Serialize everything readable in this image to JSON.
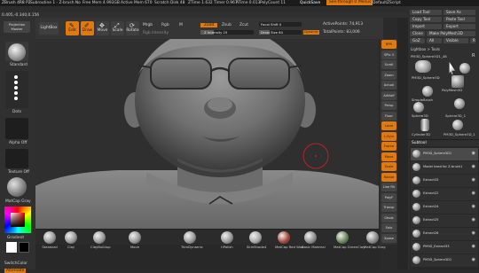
{
  "titlebar": {
    "app": "ZBrush 4R8 P2",
    "subtitle": "Subroutine 1 - Z-brush No",
    "free_mem": "Free Mem 4.993GB",
    "active_mem": "Active Mem 670",
    "scratch_disk": "Scratch Disk 48",
    "ztime": "ZTime 1.632 Timer 0.967",
    "atime": "ATime 0.013",
    "polycount": "PolyCount 11",
    "quicksave": "QuickSave",
    "see_through": "See-through 0",
    "menus_button": "Menus",
    "default_script": "DefaultZScript"
  },
  "menus": [
    "Alpha",
    "Brush",
    "Color",
    "Document",
    "Draw",
    "Edit",
    "File",
    "Layer",
    "Light",
    "Macro",
    "Marker",
    "Material",
    "Movie",
    "Picker",
    "Preferences",
    "Render",
    "Stencil",
    "Stroke",
    "Texture",
    "Tool",
    "Transform",
    "Zplugin",
    "Zscript"
  ],
  "coords": "0.405,-0.340,0.156",
  "shelf": {
    "projection_master": "Projection Master",
    "lightbox": "LightBox",
    "edit": "Edit",
    "draw": "Draw",
    "move": "Move",
    "scale": "Scale",
    "rotate": "Rotate",
    "mrgb": "Mrgb",
    "rgb": "Rgb",
    "m": "M",
    "zadd": "Zadd",
    "zsub": "Zsub",
    "zcut": "Zcut",
    "rgb_intensity": "Rgb Intensity",
    "z_intensity": "Z Intensity 25",
    "focal_shift": "Focal Shift 0",
    "draw_size": "Draw Size 64",
    "dynamic": "Dynamic",
    "active_points": "ActivePoints: 74,913",
    "total_points": "TotalPoints: 83,006"
  },
  "left_panel": {
    "brush_label": "Standard",
    "stroke_label": "Dots",
    "alpha_label": "Alpha Off",
    "texture_label": "Texture Off",
    "material_label": "MatCap Gray",
    "gradient_label": "Gradient",
    "switch_color": "SwitchColor",
    "alternate": "Alternate"
  },
  "right_tools": [
    "BPR",
    "SPix 3",
    "Scroll",
    "Zoom",
    "Actual",
    "AAHalf",
    "Persp",
    "Floor",
    "Local",
    "L.Sym",
    "Frame",
    "Move",
    "Scale",
    "Rotate",
    "Line Fill",
    "PolyF",
    "Transp",
    "Ghost",
    "Solo",
    "Xpose"
  ],
  "right_panel": {
    "load_tool": "Load Tool",
    "save_as": "Save As",
    "copy_tool": "Copy Tool",
    "paste_tool": "Paste Tool",
    "import": "Import",
    "export": "Export",
    "clone": "Clone",
    "make_polymesh": "Make PolyMesh3D",
    "goz": "GoZ",
    "all": "All",
    "visible": "Visible",
    "r": "R",
    "lightbox_tools": "Lightbox > Tools",
    "current_tool": "PM3D_Sphere3D1_48",
    "tools": [
      "PM3D_Sphere3D",
      "PolyMesh3D",
      "SimpleBrush",
      "Sphere3D",
      "Sphere3D_1",
      "Cylinder3D",
      "PM3D_Sphere3D_1"
    ],
    "subtool_header": "Subtool",
    "subtools": [
      "PM3D_Sphere3D1",
      "Model head for Z-brush1",
      "Extract33",
      "Extract22",
      "Extract24",
      "Extract25",
      "Extract26",
      "PM3D_Extract33",
      "PM3D_Sphere3D1"
    ]
  },
  "brushes": [
    "Standard",
    "Clay",
    "ClayBuildup",
    "Move",
    "TrimDynamic",
    "hPolish",
    "SkinShade4",
    "MatCap Red Wax",
    "Basic Material",
    "MatCap GreenClay",
    "MatCap Gray"
  ],
  "colors": {
    "accent": "#e07a10",
    "panel": "#303030",
    "background": "#2a2a2a"
  }
}
